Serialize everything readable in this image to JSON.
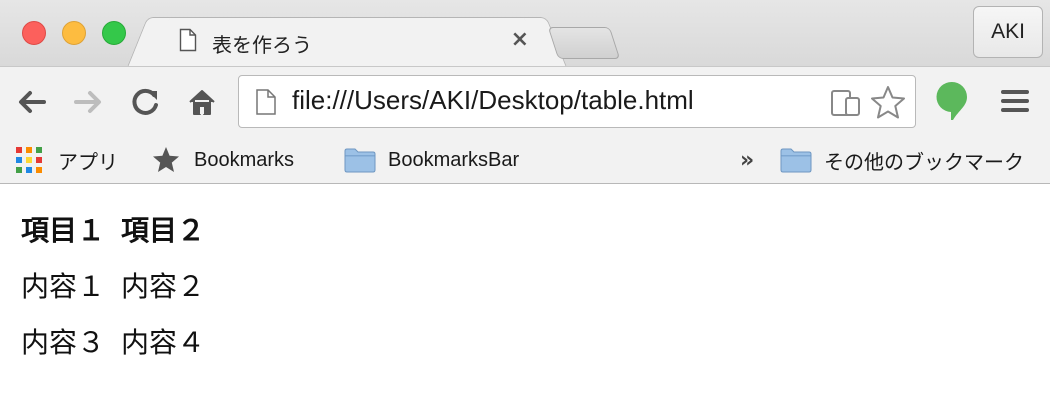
{
  "window": {
    "tab": {
      "title": "表を作ろう",
      "close_label": "×",
      "icon": "document-icon"
    },
    "profile_label": "AKI",
    "traffic_colors": {
      "close": "#fc605c",
      "minimize": "#fdbc40",
      "maximize": "#34c84a"
    }
  },
  "toolbar": {
    "back_icon": "back-arrow-icon",
    "forward_icon": "forward-arrow-icon",
    "reload_icon": "reload-icon",
    "home_icon": "home-icon",
    "url": "file:///Users/AKI/Desktop/table.html",
    "extension_color": "#5cb85c",
    "menu_icon": "hamburger-menu-icon"
  },
  "bookmarks": {
    "apps_label": "アプリ",
    "bookmarks_label": "Bookmarks",
    "bookmarks_bar_label": "BookmarksBar",
    "overflow_label": "»",
    "other_label": "その他のブックマーク"
  },
  "page": {
    "table": {
      "headers": [
        "項目１",
        "項目２"
      ],
      "rows": [
        [
          "内容１",
          "内容２"
        ],
        [
          "内容３",
          "内容４"
        ]
      ]
    }
  }
}
